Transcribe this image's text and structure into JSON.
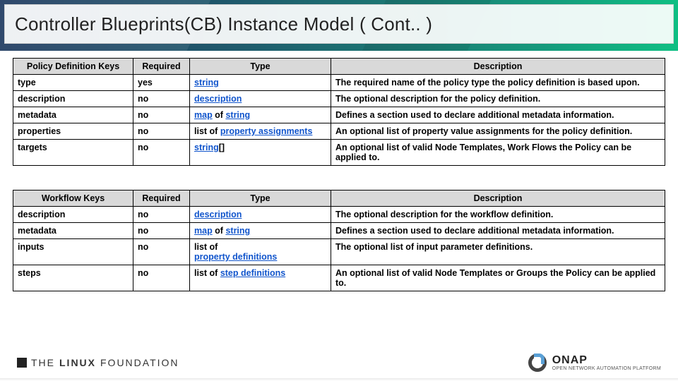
{
  "title": "Controller Blueprints(CB) Instance Model ( Cont.. )",
  "table1": {
    "headers": {
      "c1": "Policy Definition Keys",
      "c2": "Required",
      "c3": "Type",
      "c4": "Description"
    },
    "rows": [
      {
        "key": "type",
        "req": "yes",
        "type": [
          {
            "t": "string",
            "link": true
          }
        ],
        "desc": "The required name of the policy type the policy definition is based upon."
      },
      {
        "key": "description",
        "req": "no",
        "type": [
          {
            "t": "description",
            "link": true
          }
        ],
        "desc": "The optional description for the policy definition."
      },
      {
        "key": "metadata",
        "req": "no",
        "type": [
          {
            "t": "map",
            "link": true
          },
          {
            "t": " of "
          },
          {
            "t": "string",
            "link": true
          }
        ],
        "desc": "Defines a section used to declare additional metadata information."
      },
      {
        "key": "properties",
        "req": "no",
        "type": [
          {
            "t": "list of "
          },
          {
            "t": "property assignments",
            "link": true
          }
        ],
        "desc": "An optional list of property value assignments for the policy definition."
      },
      {
        "key": "targets",
        "req": "no",
        "type": [
          {
            "t": "string",
            "link": true
          },
          {
            "t": "[]"
          }
        ],
        "desc": "An optional list of valid Node Templates, Work Flows the Policy can be applied to."
      }
    ]
  },
  "table2": {
    "headers": {
      "c1": "Workflow Keys",
      "c2": "Required",
      "c3": "Type",
      "c4": "Description"
    },
    "rows": [
      {
        "key": "description",
        "req": "no",
        "type": [
          {
            "t": "description",
            "link": true
          }
        ],
        "desc": "The optional description for the workflow definition."
      },
      {
        "key": "metadata",
        "req": "no",
        "type": [
          {
            "t": "map",
            "link": true
          },
          {
            "t": " of "
          },
          {
            "t": "string",
            "link": true
          }
        ],
        "desc": "Defines a section used to declare additional metadata information."
      },
      {
        "key": "inputs",
        "req": "no",
        "type": [
          {
            "t": "list of"
          },
          {
            "t": "\n"
          },
          {
            "t": "property definitions",
            "link": true
          }
        ],
        "desc": "The optional list of input parameter definitions."
      },
      {
        "key": "steps",
        "req": "no",
        "type": [
          {
            "t": "list of "
          },
          {
            "t": "step definitions",
            "link": true
          }
        ],
        "desc": "An optional list of valid Node Templates or Groups the Policy can be applied to."
      }
    ]
  },
  "footer": {
    "lf1": "THE",
    "lf2": "LINUX",
    "lf3": "FOUNDATION",
    "onap1": "ONAP",
    "onap2": "OPEN NETWORK AUTOMATION PLATFORM"
  }
}
